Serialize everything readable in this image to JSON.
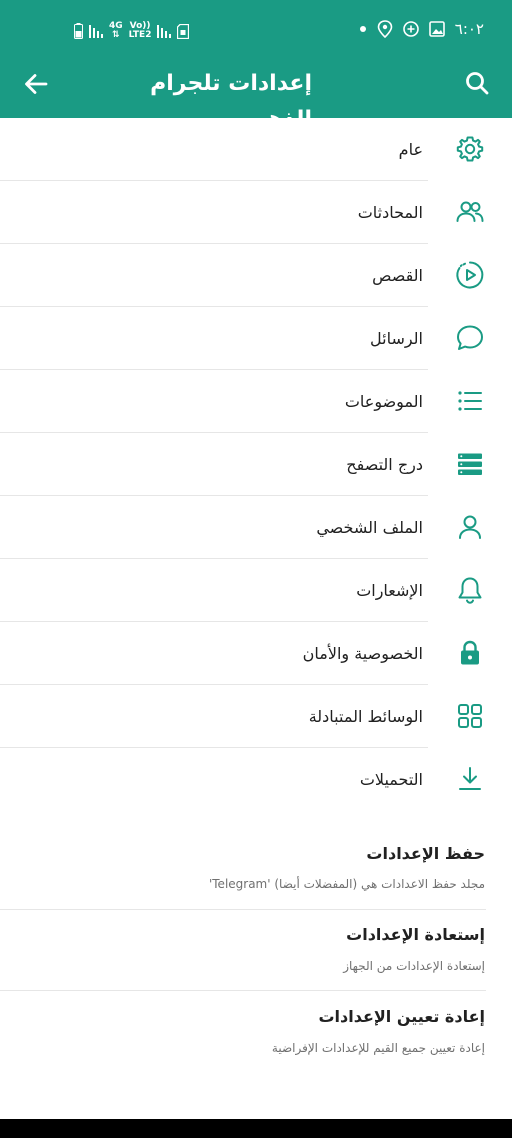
{
  "status_bar": {
    "time": "٦:٠٢",
    "network_top": "4G",
    "volte_top": "Vo))",
    "volte_bottom": "LTE2"
  },
  "toolbar": {
    "title": "إعدادات تلجرام الذهبي"
  },
  "menu_items": [
    {
      "label": "عام",
      "icon": "gear-icon"
    },
    {
      "label": "المحادثات",
      "icon": "people-icon"
    },
    {
      "label": "القصص",
      "icon": "story-play-icon"
    },
    {
      "label": "الرسائل",
      "icon": "chat-bubble-icon"
    },
    {
      "label": "الموضوعات",
      "icon": "list-icon"
    },
    {
      "label": "درج التصفح",
      "icon": "drawer-icon"
    },
    {
      "label": "الملف الشخصي",
      "icon": "person-icon"
    },
    {
      "label": "الإشعارات",
      "icon": "bell-icon"
    },
    {
      "label": "الخصوصية والأمان",
      "icon": "lock-icon"
    },
    {
      "label": "الوسائط المتبادلة",
      "icon": "grid-icon"
    },
    {
      "label": "التحميلات",
      "icon": "download-icon"
    }
  ],
  "backup": {
    "save": {
      "title": "حفظ الإعدادات",
      "subtitle": "مجلد حفظ الاعدادات هي (المفضلات أيضا) 'Telegram'"
    },
    "restore": {
      "title": "إستعادة الإعدادات",
      "subtitle": "إستعادة الإعدادات من الجهاز"
    },
    "reset": {
      "title": "إعادة تعيين الإعدادات",
      "subtitle": "إعادة تعيين جميع القيم للإعدادات الإفراضية"
    }
  },
  "colors": {
    "accent": "#1a9b84",
    "icon": "#1a9b84"
  }
}
